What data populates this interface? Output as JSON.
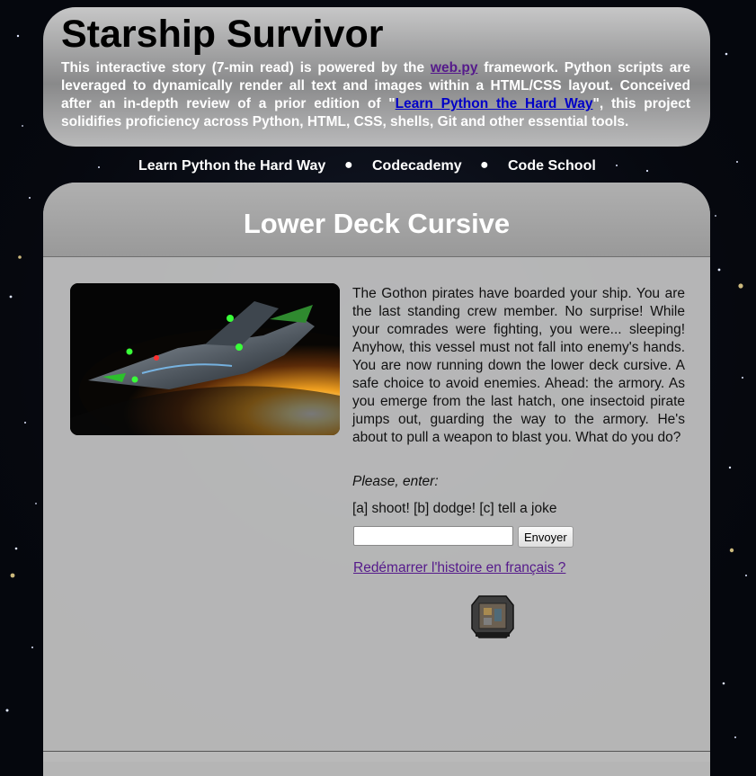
{
  "header": {
    "title": "Starship Survivor",
    "intro_before_webpy": "This interactive story (7-min read) is powered by the ",
    "webpy_link": "web.py",
    "intro_after_webpy": " framework. Python scripts are leveraged to dynamically render all text and images within a HTML/CSS layout. Conceived after an in-depth review of a prior edition of \"",
    "lpthw_link": "Learn Python the Hard Way",
    "intro_end": "\", this project solidifies proficiency across Python, HTML, CSS, shells, Git and other essential tools."
  },
  "nav": {
    "items": [
      "Learn Python the Hard Way",
      "Codecademy",
      "Code School"
    ],
    "separator": "●"
  },
  "scene": {
    "title": "Lower Deck Cursive",
    "image_alt": "spaceship",
    "story": "The Gothon pirates have boarded your ship. You are the last standing crew member. No surprise! While your comrades were fighting, you were... sleeping! Anyhow, this vessel must not fall into enemy's hands. You are now running down the lower deck cursive. A safe choice to avoid enemies. Ahead: the armory. As you emerge from the last hatch, one insectoid pirate jumps out, guarding the way to the armory. He's about to pull a weapon to blast you. What do you do?",
    "prompt": "Please, enter:",
    "choices": "[a] shoot! [b] dodge! [c] tell a joke",
    "input_value": "",
    "submit_label": "Envoyer",
    "restart_link": "Redémarrer l'histoire en français ?"
  },
  "icons": {
    "ship_map": "ship-map-icon"
  },
  "colors": {
    "title": "#000000",
    "heading": "#ffffff",
    "link": "#0000c8",
    "visited_link": "#551a8b",
    "panel": "#c3c3c3"
  }
}
